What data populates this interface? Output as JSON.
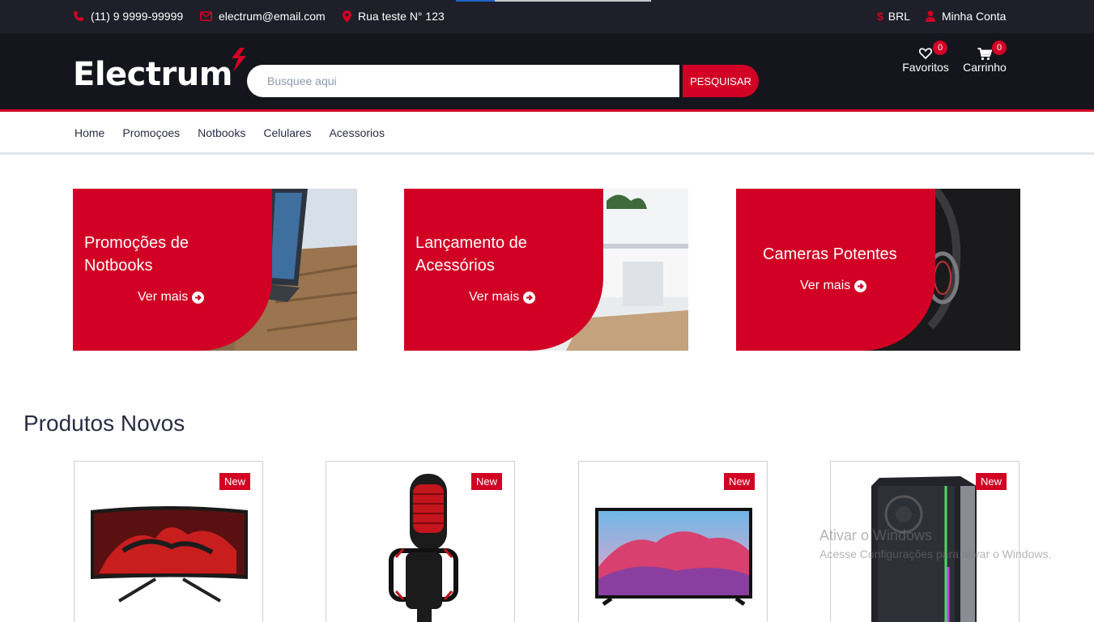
{
  "topbar": {
    "phone": "(11) 9 9999-99999",
    "email": "electrum@email.com",
    "address": "Rua teste N° 123",
    "currency": "BRL",
    "account": "Minha Conta"
  },
  "header": {
    "logo": "Electrum",
    "search_placeholder": "Busquee aqui",
    "search_button": "PESQUISAR",
    "wishlist_label": "Favoritos",
    "wishlist_count": "0",
    "cart_label": "Carrinho",
    "cart_count": "0"
  },
  "nav": {
    "items": [
      "Home",
      "Promoçoes",
      "Notbooks",
      "Celulares",
      "Acessorios"
    ]
  },
  "collections": [
    {
      "line1": "Promoções de",
      "line2": "Notbooks",
      "cta": "Ver mais"
    },
    {
      "line1": "Lançamento de",
      "line2": "Acessórios",
      "cta": "Ver mais"
    },
    {
      "line1": "Cameras Potentes",
      "cta": "Ver mais"
    }
  ],
  "section_title": "Produtos Novos",
  "products": [
    {
      "badge": "New",
      "image": "curved-gaming-monitor"
    },
    {
      "badge": "New",
      "image": "red-microphone"
    },
    {
      "badge": "New",
      "image": "flat-tv"
    },
    {
      "badge": "New",
      "image": "pc-tower"
    }
  ],
  "watermark": {
    "title": "Ativar o Windows",
    "subtitle": "Acesse Configurações para ativar o Windows."
  },
  "colors": {
    "accent": "#d10024",
    "topbar": "#1e1f29",
    "header": "#15161d"
  }
}
